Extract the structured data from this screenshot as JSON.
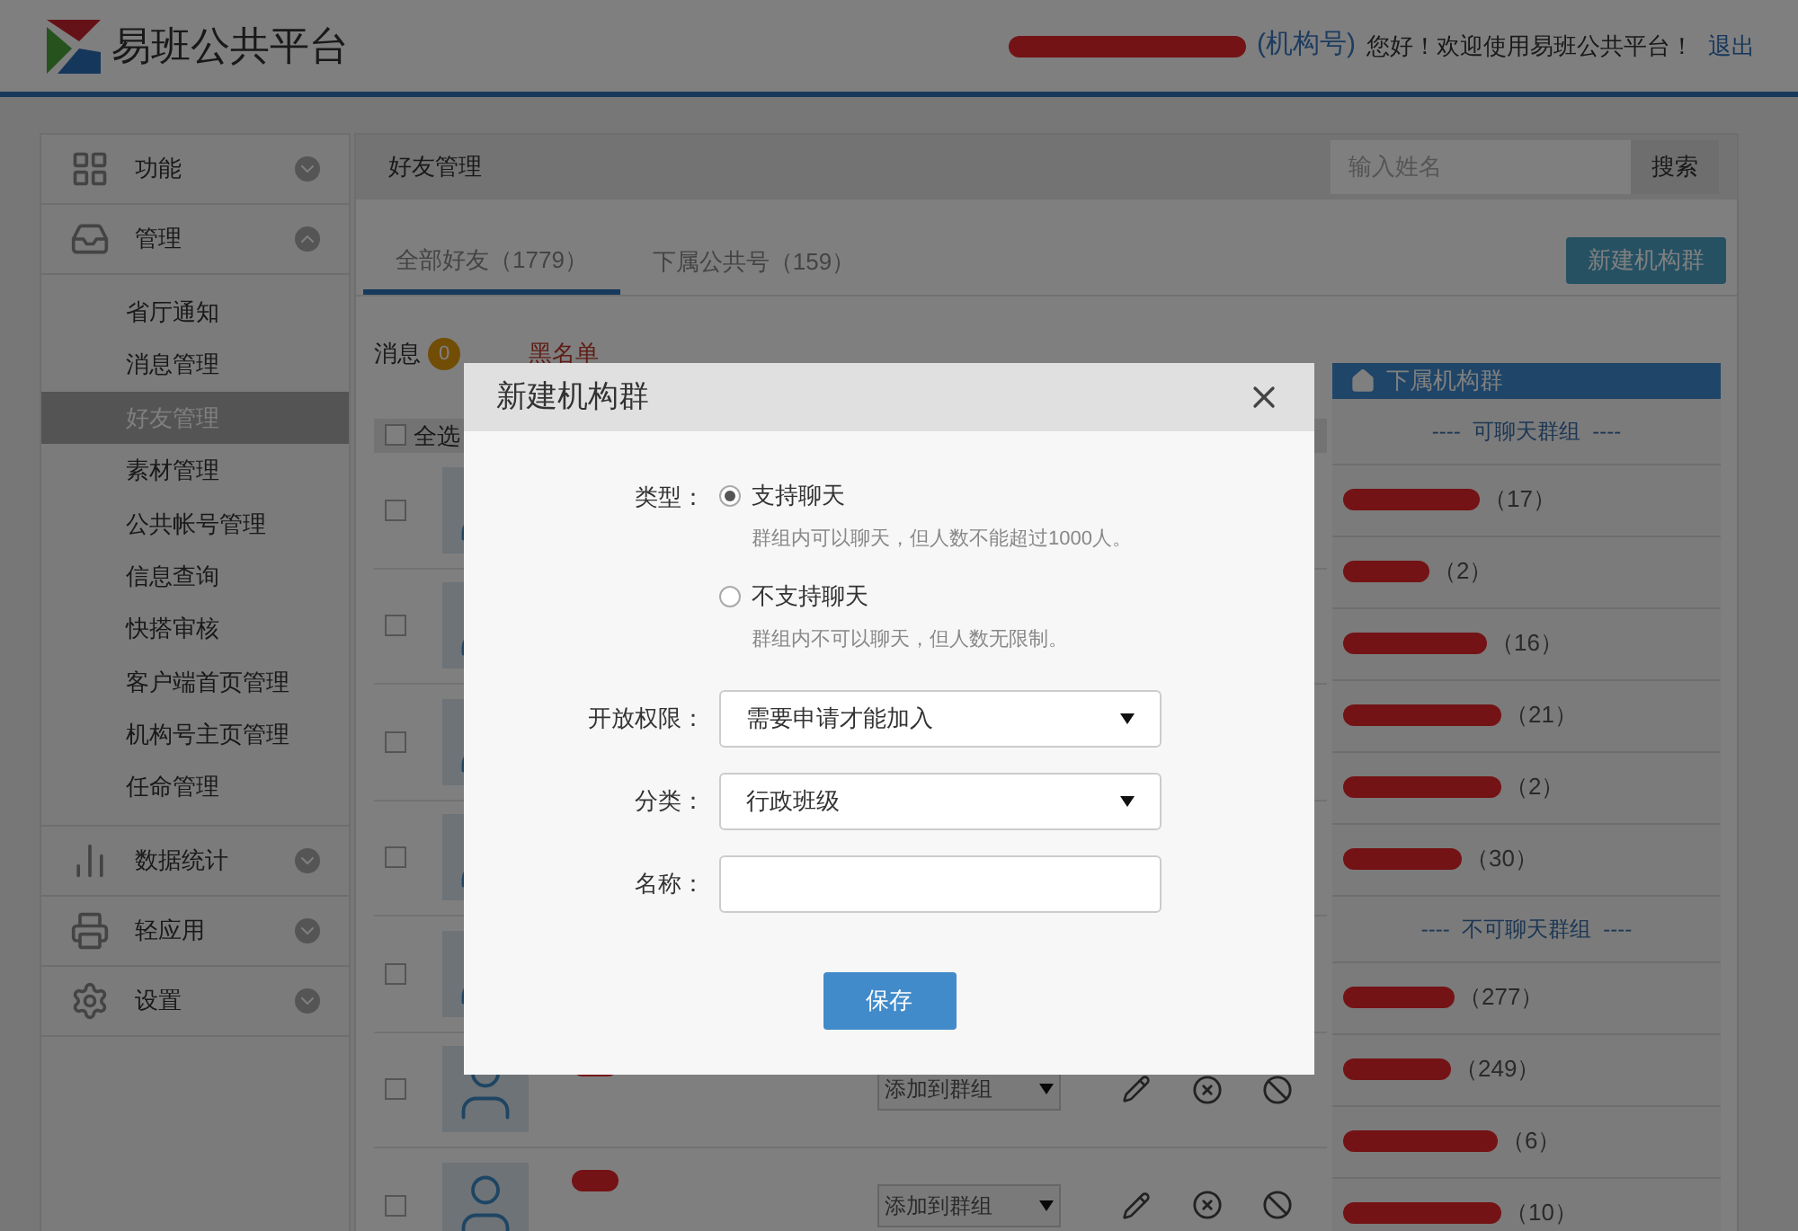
{
  "header": {
    "logo_text": "易班公共平台",
    "account_type": "(机构号)",
    "greeting": "您好！欢迎使用易班公共平台！",
    "logout": "退出"
  },
  "sidebar": {
    "items": [
      {
        "label": "功能",
        "expanded": false
      },
      {
        "label": "管理",
        "expanded": true,
        "children": [
          {
            "label": "省厅通知",
            "selected": false
          },
          {
            "label": "消息管理",
            "selected": false
          },
          {
            "label": "好友管理",
            "selected": true
          },
          {
            "label": "素材管理",
            "selected": false
          },
          {
            "label": "公共帐号管理",
            "selected": false
          },
          {
            "label": "信息查询",
            "selected": false
          },
          {
            "label": "快搭审核",
            "selected": false
          },
          {
            "label": "客户端首页管理",
            "selected": false
          },
          {
            "label": "机构号主页管理",
            "selected": false
          },
          {
            "label": "任命管理",
            "selected": false
          }
        ]
      },
      {
        "label": "数据统计",
        "expanded": false
      },
      {
        "label": "轻应用",
        "expanded": false
      },
      {
        "label": "设置",
        "expanded": false
      }
    ]
  },
  "page": {
    "title": "好友管理",
    "search": {
      "placeholder": "输入姓名",
      "button": "搜索"
    },
    "tabs": [
      {
        "label": "全部好友（1779）",
        "selected": true
      },
      {
        "label": "下属公共号（159）",
        "selected": false
      }
    ],
    "new_group_button": "新建机构群",
    "message": {
      "label": "消息",
      "count": "0"
    },
    "blacklist": "黑名单",
    "select_all": {
      "label": "全选",
      "checked": false
    },
    "friends": [
      {
        "checked": false
      },
      {
        "checked": false
      },
      {
        "checked": false
      },
      {
        "checked": false
      },
      {
        "checked": false
      },
      {
        "checked": false,
        "group_select": "添加到群组"
      },
      {
        "checked": false,
        "group_select": "添加到群组"
      }
    ]
  },
  "groups_panel": {
    "title": "下属机构群",
    "sections": [
      {
        "heading": "----  可聊天群组  ----",
        "items": [
          {
            "count": "（17）"
          },
          {
            "count": "（2）"
          },
          {
            "count": "（16）"
          },
          {
            "count": "（21）"
          },
          {
            "count": "（2）"
          },
          {
            "count": "（30）"
          }
        ]
      },
      {
        "heading": "----  不可聊天群组  ----",
        "items": [
          {
            "count": "（277）"
          },
          {
            "count": "（249）"
          },
          {
            "count": "（6）"
          },
          {
            "count": "（10）"
          }
        ]
      }
    ]
  },
  "dialog": {
    "title": "新建机构群",
    "type": {
      "label": "类型：",
      "options": [
        {
          "label": "支持聊天",
          "hint": "群组内可以聊天，但人数不能超过1000人。",
          "selected": true
        },
        {
          "label": "不支持聊天",
          "hint": "群组内不可以聊天，但人数无限制。",
          "selected": false
        }
      ]
    },
    "selects": [
      {
        "label": "开放权限：",
        "value": "需要申请才能加入"
      },
      {
        "label": "分类：",
        "value": "行政班级"
      }
    ],
    "name": {
      "label": "名称："
    },
    "save": "保存"
  }
}
